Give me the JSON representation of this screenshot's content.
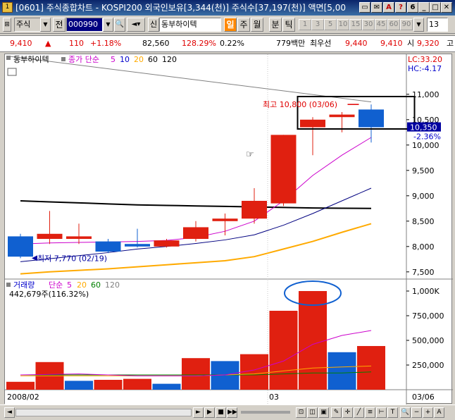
{
  "window": {
    "app_icon": "1",
    "title": "[0601] 주식종합차트 - KOSPI200 외국인보유[3,344(천)] 주식수[37,197(천)] 액면[5,00",
    "buttons": [
      "▭",
      "✉",
      "A",
      "?",
      "6",
      "_",
      "□",
      "✕"
    ]
  },
  "toolbar": {
    "market": "주식",
    "market_all": "전",
    "code": "000990",
    "new_label": "신",
    "stock_name": "동부하이텍",
    "periods": [
      "일",
      "주",
      "월"
    ],
    "intraday": [
      "분",
      "틱"
    ],
    "minute_steps": [
      "1",
      "3",
      "5",
      "10",
      "15",
      "30",
      "45",
      "60",
      "90"
    ],
    "count": "13"
  },
  "quote": {
    "price": "9,410",
    "change_arrow": "▲",
    "change": "110",
    "change_pct": "+1.18%",
    "volume": "82,560",
    "volume_ratio": "128.29%",
    "turnover": "0.22%",
    "amount": "779백만",
    "best_ask_label": "최우선",
    "best_ask": "9,440",
    "best_bid": "9,410",
    "open_label": "시",
    "open": "9,320",
    "high_label": "고"
  },
  "chart_data": [
    {
      "type": "candlestick",
      "title": "동부하이텍",
      "indicator_label": "종가 단순",
      "ma_periods": [
        "5",
        "10",
        "20",
        "60",
        "120"
      ],
      "ma_colors": [
        "#cc00cc",
        "#0000cc",
        "#ffaa00",
        "#008000",
        "#000000"
      ],
      "ohlc": [
        {
          "o": 8200,
          "h": 8250,
          "l": 7770,
          "c": 7800
        },
        {
          "o": 8150,
          "h": 8700,
          "l": 8050,
          "c": 8250
        },
        {
          "o": 8150,
          "h": 8450,
          "l": 8050,
          "c": 8200
        },
        {
          "o": 8100,
          "h": 8150,
          "l": 7870,
          "c": 7900
        },
        {
          "o": 8050,
          "h": 8350,
          "l": 7980,
          "c": 8000
        },
        {
          "o": 8000,
          "h": 8150,
          "l": 7980,
          "c": 8120
        },
        {
          "o": 8150,
          "h": 8500,
          "l": 8100,
          "c": 8380
        },
        {
          "o": 8500,
          "h": 8650,
          "l": 8220,
          "c": 8550
        },
        {
          "o": 8550,
          "h": 9150,
          "l": 8450,
          "c": 8900
        },
        {
          "o": 8850,
          "h": 10200,
          "l": 8800,
          "c": 10200
        },
        {
          "o": 10350,
          "h": 10550,
          "l": 9800,
          "c": 10500
        },
        {
          "o": 10550,
          "h": 10650,
          "l": 10250,
          "c": 10600
        },
        {
          "o": 10700,
          "h": 10800,
          "l": 10050,
          "c": 10350
        }
      ],
      "ma5": [
        8050,
        8070,
        8080,
        8090,
        8100,
        8120,
        8180,
        8300,
        8500,
        8900,
        9400,
        9800,
        10150
      ],
      "ma10": [
        7700,
        7760,
        7820,
        7880,
        7950,
        8000,
        8060,
        8130,
        8230,
        8420,
        8650,
        8900,
        9150
      ],
      "ma20": [
        7460,
        7500,
        7530,
        7560,
        7600,
        7640,
        7680,
        7720,
        7800,
        7950,
        8100,
        8280,
        8450
      ],
      "ma120": [
        8900,
        8880,
        8860,
        8840,
        8820,
        8810,
        8800,
        8790,
        8780,
        8770,
        8760,
        8755,
        8750
      ],
      "ylim": [
        7400,
        11400
      ],
      "yticks": [
        "11,000",
        "10,500",
        "10,000",
        "9,500",
        "9,000",
        "8,500",
        "8,000",
        "7,500"
      ],
      "lc_label": "LC:33.20",
      "hc_label": "HC:-4.17",
      "current_price_label": "10,350",
      "current_change_label": "-2.36%",
      "high_annotation": "최고 10,800 (03/06)",
      "low_annotation": "최저 7,770 (02/19)"
    },
    {
      "type": "bar",
      "title": "거래량",
      "indicator_label": "단순",
      "ma_periods": [
        "5",
        "20",
        "60",
        "120"
      ],
      "ma_colors": [
        "#cc00cc",
        "#ffaa00",
        "#008000",
        "#a0a0a0"
      ],
      "current_volume_label": "442,679주(116.32%)",
      "values": [
        80000,
        280000,
        90000,
        100000,
        110000,
        60000,
        320000,
        290000,
        360000,
        800000,
        1000000,
        380000,
        442679
      ],
      "up": [
        true,
        true,
        false,
        true,
        true,
        false,
        true,
        false,
        true,
        true,
        true,
        false,
        true
      ],
      "ma5": [
        150000,
        155000,
        160000,
        150000,
        140000,
        140000,
        140000,
        150000,
        200000,
        290000,
        460000,
        550000,
        600000
      ],
      "ma20": [
        140000,
        140000,
        140000,
        140000,
        140000,
        140000,
        140000,
        150000,
        160000,
        190000,
        220000,
        230000,
        240000
      ],
      "ma60": [
        150000,
        150000,
        150000,
        150000,
        150000,
        150000,
        150000,
        150000,
        150000,
        160000,
        170000,
        170000,
        180000
      ],
      "ylim": [
        0,
        1100000
      ],
      "yticks": [
        "1,000K",
        "750,000",
        "500,000",
        "250,000"
      ]
    }
  ],
  "xaxis": {
    "labels": [
      "2008/02",
      "03",
      "03/06"
    ]
  }
}
